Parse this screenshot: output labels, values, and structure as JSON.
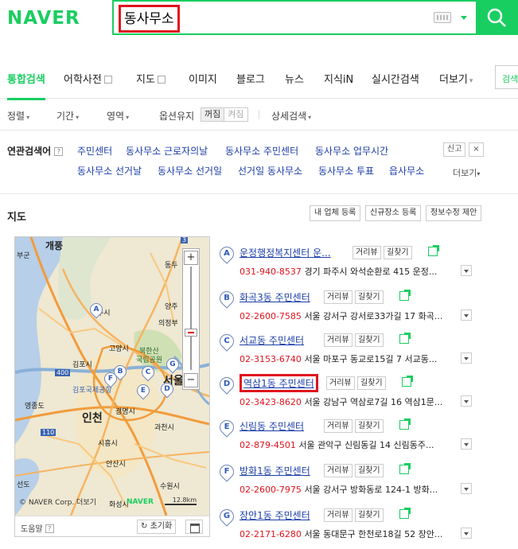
{
  "brand": {
    "logo": "NAVER",
    "color": "#19ce60"
  },
  "search": {
    "query": "동사무소",
    "icon": "search-icon"
  },
  "tabs": [
    {
      "label": "통합검색",
      "active": true
    },
    {
      "label": "어학사전"
    },
    {
      "label": "지도"
    },
    {
      "label": "이미지"
    },
    {
      "label": "블로그"
    },
    {
      "label": "뉴스"
    },
    {
      "label": "지식iN"
    },
    {
      "label": "실시간검색"
    },
    {
      "label": "더보기"
    }
  ],
  "tab_right_button": "검색",
  "filters": {
    "sort": "정렬",
    "period": "기간",
    "area": "영역",
    "option_keep": "옵션유지",
    "toggle_on": "꺼짐",
    "toggle_off": "켜짐",
    "detail": "상세검색"
  },
  "related": {
    "title": "연관검색어",
    "help": "?",
    "row1": [
      "주민센터",
      "동사무소 근로자의날",
      "동사무소 주민센터",
      "동사무소 업무시간"
    ],
    "row2": [
      "동사무소 선거날",
      "동사무소 선거일",
      "선거일 동사무소",
      "동사무소 투표",
      "읍사무소"
    ],
    "report": "신고",
    "close": "×",
    "more": "더보기"
  },
  "map_section": {
    "title": "지도",
    "btn_register": "내 업체 등록",
    "btn_new_place": "신규장소 등록",
    "btn_suggest": "정보수정 제안",
    "labels": {
      "top": "개풍",
      "gunsan": "부군",
      "dongducheon": "동두",
      "yangju": "양주",
      "uijeongbu": "의정부",
      "juseo": "주시",
      "goyang": "고양시",
      "bukhansan": "북한산",
      "gungnip": "국립공원",
      "gimpo": "김포시",
      "airport": "김포국제공항",
      "seoul": "서울",
      "yeongjong": "영종도",
      "incheon": "인천",
      "gwangmyeong": "광명시",
      "gwacheon": "과천시",
      "siheung": "시흥시",
      "ansan": "안산시",
      "suwon": "수원시",
      "jeongseon": "선도",
      "hwaseong": "화성시",
      "road400": "400",
      "road110": "110",
      "road3": "3"
    },
    "copyright": "© NAVER Corp. 더보기",
    "map_logo": "NAVER",
    "scale": "12.8km",
    "helper": "도움말",
    "helper_icon": "?",
    "reset": "초기화",
    "zoom_in": "+",
    "zoom_out": "−"
  },
  "places": [
    {
      "letter": "A",
      "name": "운정행정복지센터 운...",
      "phone": "031-940-8537",
      "addr": "경기 파주시 와석순환로 415 운정...",
      "highlight": false
    },
    {
      "letter": "B",
      "name": "화곡3동 주민센터",
      "phone": "02-2600-7585",
      "addr": "서울 강서구 강서로33가길 17 화곡...",
      "highlight": false
    },
    {
      "letter": "C",
      "name": "서교동 주민센터",
      "phone": "02-3153-6740",
      "addr": "서울 마포구 동교로15길 7 서교동...",
      "highlight": false
    },
    {
      "letter": "D",
      "name": "역삼1동 주민센터",
      "phone": "02-3423-8620",
      "addr": "서울 강남구 역삼로7길 16 역삼1문...",
      "highlight": true
    },
    {
      "letter": "E",
      "name": "신림동 주민센터",
      "phone": "02-879-4501",
      "addr": "서울 관악구 신림동길 14 신림동주...",
      "highlight": false
    },
    {
      "letter": "F",
      "name": "방화1동 주민센터",
      "phone": "02-2600-7975",
      "addr": "서울 강서구 방화동로 124-1 방화...",
      "highlight": false
    },
    {
      "letter": "G",
      "name": "장안1동 주민센터",
      "phone": "02-2171-6280",
      "addr": "서울 동대문구 한천로18길 52 장안...",
      "highlight": false
    }
  ],
  "place_buttons": {
    "roadview": "거리뷰",
    "directions": "길찾기"
  }
}
